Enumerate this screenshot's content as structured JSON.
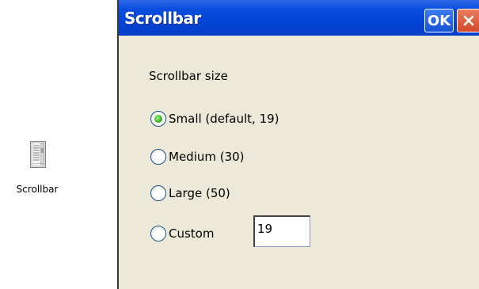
{
  "desktop": {
    "icon": "scrollbar-settings-icon",
    "label": "Scrollbar"
  },
  "dialog": {
    "title": "Scrollbar",
    "ok_label": "OK",
    "close_icon": "close-icon",
    "section_label": "Scrollbar size",
    "options": [
      {
        "label": "Small (default, 19)",
        "selected": true
      },
      {
        "label": "Medium (30)",
        "selected": false
      },
      {
        "label": "Large (50)",
        "selected": false
      },
      {
        "label": "Custom",
        "selected": false
      }
    ],
    "custom_value": "19"
  },
  "colors": {
    "titlebar": "#0a4ee0",
    "window_bg": "#ece9d8",
    "close_button": "#d34a2a",
    "radio_selected": "#3cb925"
  }
}
